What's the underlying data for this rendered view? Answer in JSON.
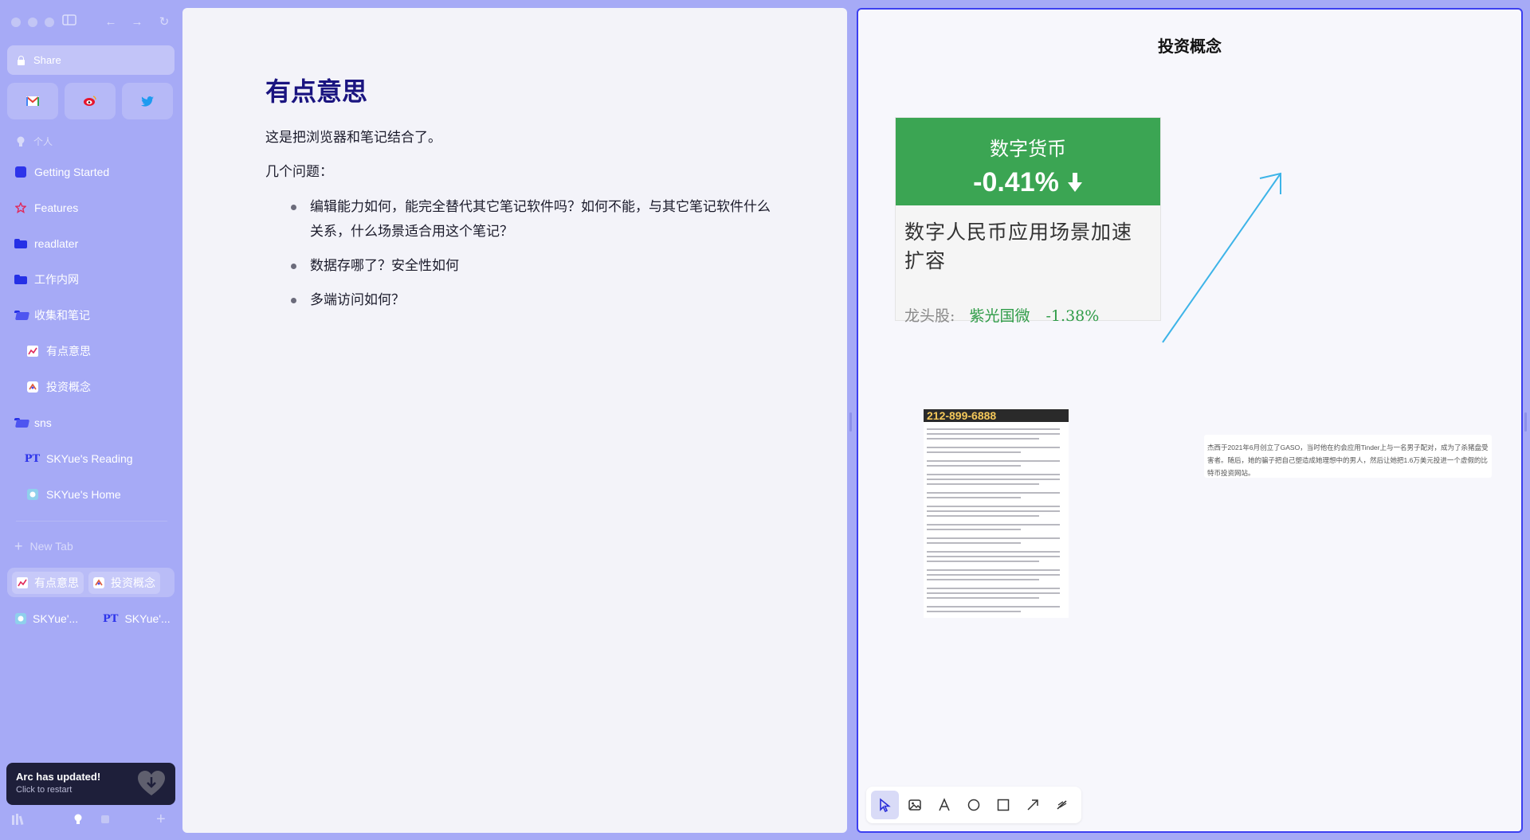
{
  "sidebar": {
    "share_label": "Share",
    "favorites": [
      {
        "name": "gmail-icon"
      },
      {
        "name": "weibo-icon"
      },
      {
        "name": "twitter-icon"
      }
    ],
    "section_label": "个人",
    "items": [
      {
        "label": "Getting Started"
      },
      {
        "label": "Features"
      },
      {
        "label": "readlater"
      },
      {
        "label": "工作内网"
      },
      {
        "label": "收集和笔记"
      },
      {
        "label": "有点意思"
      },
      {
        "label": "投资概念"
      },
      {
        "label": "sns"
      },
      {
        "label": "SKYue's Reading"
      },
      {
        "label": "SKYue's Home"
      }
    ],
    "new_tab_label": "New Tab",
    "split_tabs": [
      {
        "label": "有点意思"
      },
      {
        "label": "投资概念"
      }
    ],
    "tabs": [
      {
        "label": "SKYue'..."
      },
      {
        "label": "SKYue'..."
      }
    ],
    "update": {
      "title": "Arc has updated!",
      "subtitle": "Click to restart"
    }
  },
  "note": {
    "title": "有点意思",
    "para1": "这是把浏览器和笔记结合了。",
    "para2": "几个问题：",
    "bullets": [
      "编辑能力如何，能完全替代其它笔记软件吗？如何不能，与其它笔记软件什么关系，什么场景适合用这个笔记？",
      "数据存哪了？安全性如何",
      "多端访问如何？"
    ]
  },
  "canvas": {
    "title": "投资概念",
    "card": {
      "category": "数字货币",
      "change": "-0.41%",
      "headline": "数字人民币应用场景加速扩容",
      "leader_label": "龙头股:",
      "leader_stock": "紫光国微",
      "leader_change": "-1.38%"
    },
    "doc_banner": "212-899-6888",
    "text_note": "杰西于2021年6月创立了GASO，当时他在约会应用Tinder上与一名男子配对，成为了杀猪盘受害者。随后，她的骗子把自己塑造成她理想中的男人，然后让她把1.6万美元投进一个虚假的比特币投资网站。",
    "tools": [
      {
        "name": "select-tool"
      },
      {
        "name": "image-tool"
      },
      {
        "name": "text-tool"
      },
      {
        "name": "circle-tool"
      },
      {
        "name": "rectangle-tool"
      },
      {
        "name": "arrow-tool"
      },
      {
        "name": "pen-tool"
      }
    ]
  },
  "colors": {
    "accent": "#3c3ff0",
    "card_green": "#3ba553",
    "arrow_blue": "#3db4e8",
    "title_navy": "#1a1480"
  }
}
